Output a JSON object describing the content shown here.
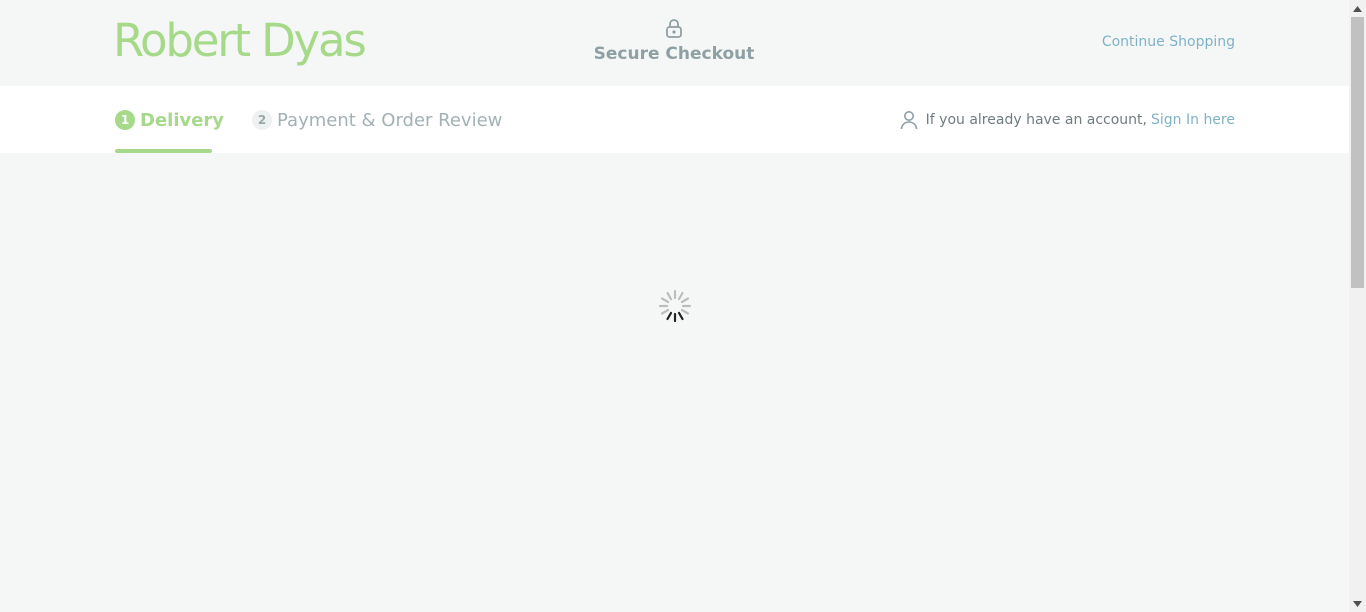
{
  "header": {
    "logo_text": "Robert Dyas",
    "secure_label": "Secure Checkout",
    "continue_label": "Continue Shopping"
  },
  "steps": [
    {
      "number": "1",
      "label": "Delivery",
      "active": true
    },
    {
      "number": "2",
      "label": "Payment & Order Review",
      "active": false
    }
  ],
  "account": {
    "prompt": "If you already have an account,",
    "signin_label": "Sign In here"
  },
  "icons": {
    "lock": "lock-icon",
    "user": "user-icon",
    "spinner": "loading-spinner-icon"
  },
  "colors": {
    "brand_green": "#a7d98a",
    "link_blue": "#7fb2c6",
    "background": "#f5f7f6"
  }
}
